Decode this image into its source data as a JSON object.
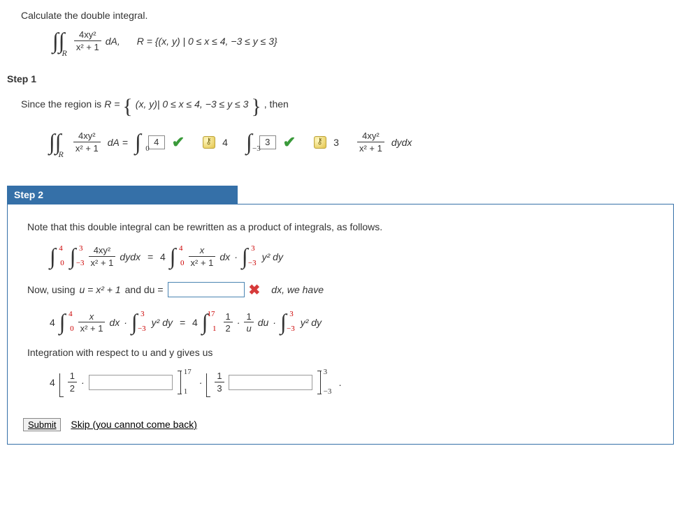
{
  "prompt": "Calculate the double integral.",
  "integrand": {
    "numer": "4xy²",
    "denom": "x² + 1"
  },
  "dA": "dA,",
  "region_text": "R = {(x, y) | 0 ≤ x ≤ 4, −3 ≤ y ≤ 3}",
  "step1": {
    "title": "Step 1",
    "prefix": "Since the region is ",
    "region_inline": "(x, y)| 0 ≤ x ≤ 4, −3 ≤ y ≤ 3",
    "suffix": ", then",
    "R_eq": "R = ",
    "ans": {
      "outer_upper": "4",
      "outer_lower": "0",
      "inner_upper": "3",
      "inner_lower": "−3",
      "key_a": "4",
      "key_b": "3"
    },
    "dydx": "dydx"
  },
  "step2": {
    "tab": "Step 2",
    "line1": "Note that this double integral can be rewritten as a product of integrals, as follows.",
    "line2_prefix": "Now, using ",
    "u_def": "u = x² + 1",
    "and_du": " and du = ",
    "dx_have": "dx, we have",
    "four": "4",
    "line3": "Integration with respect to u and y gives us",
    "limits": {
      "a_up": "4",
      "a_lo": "0",
      "b_up": "3",
      "b_lo": "−3",
      "c_up": "17",
      "c_lo": "1"
    },
    "frac_xa": {
      "num": "x",
      "den": "x² + 1"
    },
    "frac_half": {
      "num": "1",
      "den": "2"
    },
    "frac_u": {
      "num": "1",
      "den": "u"
    },
    "frac_third": {
      "num": "1",
      "den": "3"
    },
    "y2dy": "y² dy",
    "du": "du",
    "dx": "dx",
    "dot": "·"
  },
  "actions": {
    "submit": "Submit",
    "skip": "Skip (you cannot come back)"
  },
  "chart_data": {
    "type": "table",
    "title": "Double integral parameters",
    "values": {
      "integrand": "4xy^2 / (x^2 + 1)",
      "x_range": [
        0,
        4
      ],
      "y_range": [
        -3,
        3
      ],
      "u_substitution": "u = x^2 + 1",
      "u_range": [
        1,
        17
      ]
    }
  }
}
